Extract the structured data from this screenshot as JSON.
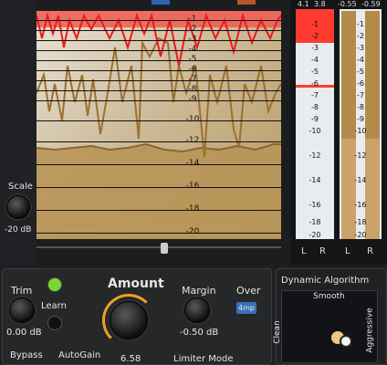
{
  "graph": {
    "db_labels": [
      "-1",
      "-2",
      "-3",
      "-4",
      "-5",
      "-6",
      "-7",
      "-8",
      "-9",
      "-10",
      "-12",
      "-14",
      "-16",
      "-18",
      "-20"
    ]
  },
  "scale": {
    "label": "Scale",
    "value": "-20 dB"
  },
  "meters": {
    "top_values": [
      "4.1",
      "3.8",
      "-0.55",
      "-0.59"
    ],
    "labels": [
      "-1",
      "-2",
      "-3",
      "-4",
      "-5",
      "-6",
      "-7",
      "-8",
      "-9",
      "-10",
      "-12",
      "-14",
      "-16",
      "-18",
      "-20"
    ],
    "left_channels": [
      "L",
      "R"
    ],
    "right_channels": [
      "L",
      "R"
    ],
    "gain_reduction_color": "#ff3b2f"
  },
  "controls": {
    "trim_label": "Trim",
    "trim_value": "0.00 dB",
    "learn_label": "Learn",
    "amount_label": "Amount",
    "amount_value": "6.58",
    "margin_label": "Margin",
    "margin_value": "-0.50 dB",
    "over_label": "Over",
    "over_badge": "4mp",
    "bypass_label": "Bypass",
    "autogain_label": "AutoGain",
    "limiter_mode_label": "Limiter Mode"
  },
  "algorithm": {
    "title": "Dynamic Algorithm",
    "top_label": "Smooth",
    "left_label": "Clean",
    "right_label": "Aggressive"
  },
  "colors": {
    "accent": "#f0a020",
    "learn_led": "#7cd33a",
    "over_badge_bg": "#3a6fb5"
  }
}
